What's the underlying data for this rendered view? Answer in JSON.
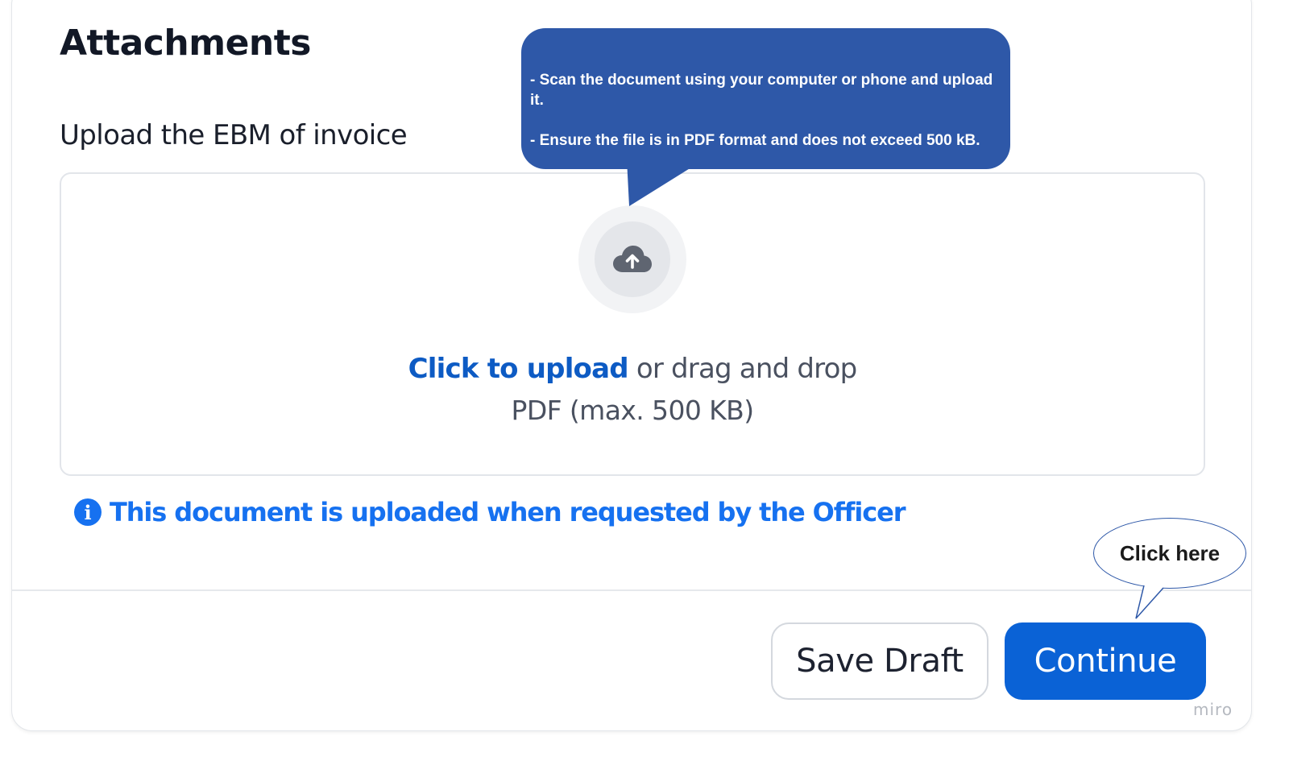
{
  "section": {
    "title": "Attachments"
  },
  "upload": {
    "label": "Upload the EBM of invoice",
    "icon": "cloud-upload-icon",
    "click_text": "Click to upload",
    "drag_text": "or drag and drop",
    "format_text": "PDF (max. 500 KB)"
  },
  "info": {
    "icon": "info-icon",
    "icon_glyph": "i",
    "text": "This document is uploaded when requested by the Officer"
  },
  "buttons": {
    "save_draft": "Save Draft",
    "continue": "Continue"
  },
  "tooltip": {
    "line1": "- Scan the document using your computer or phone and upload it.",
    "line2": "- Ensure the file is in PDF format and does not exceed 500 kB."
  },
  "callout": {
    "text": "Click here"
  },
  "watermark": {
    "text": "miro"
  },
  "colors": {
    "primary": "#0a62d6",
    "link": "#0d5bc4",
    "info": "#1671f0",
    "tooltip_bg": "#2e58a8"
  }
}
